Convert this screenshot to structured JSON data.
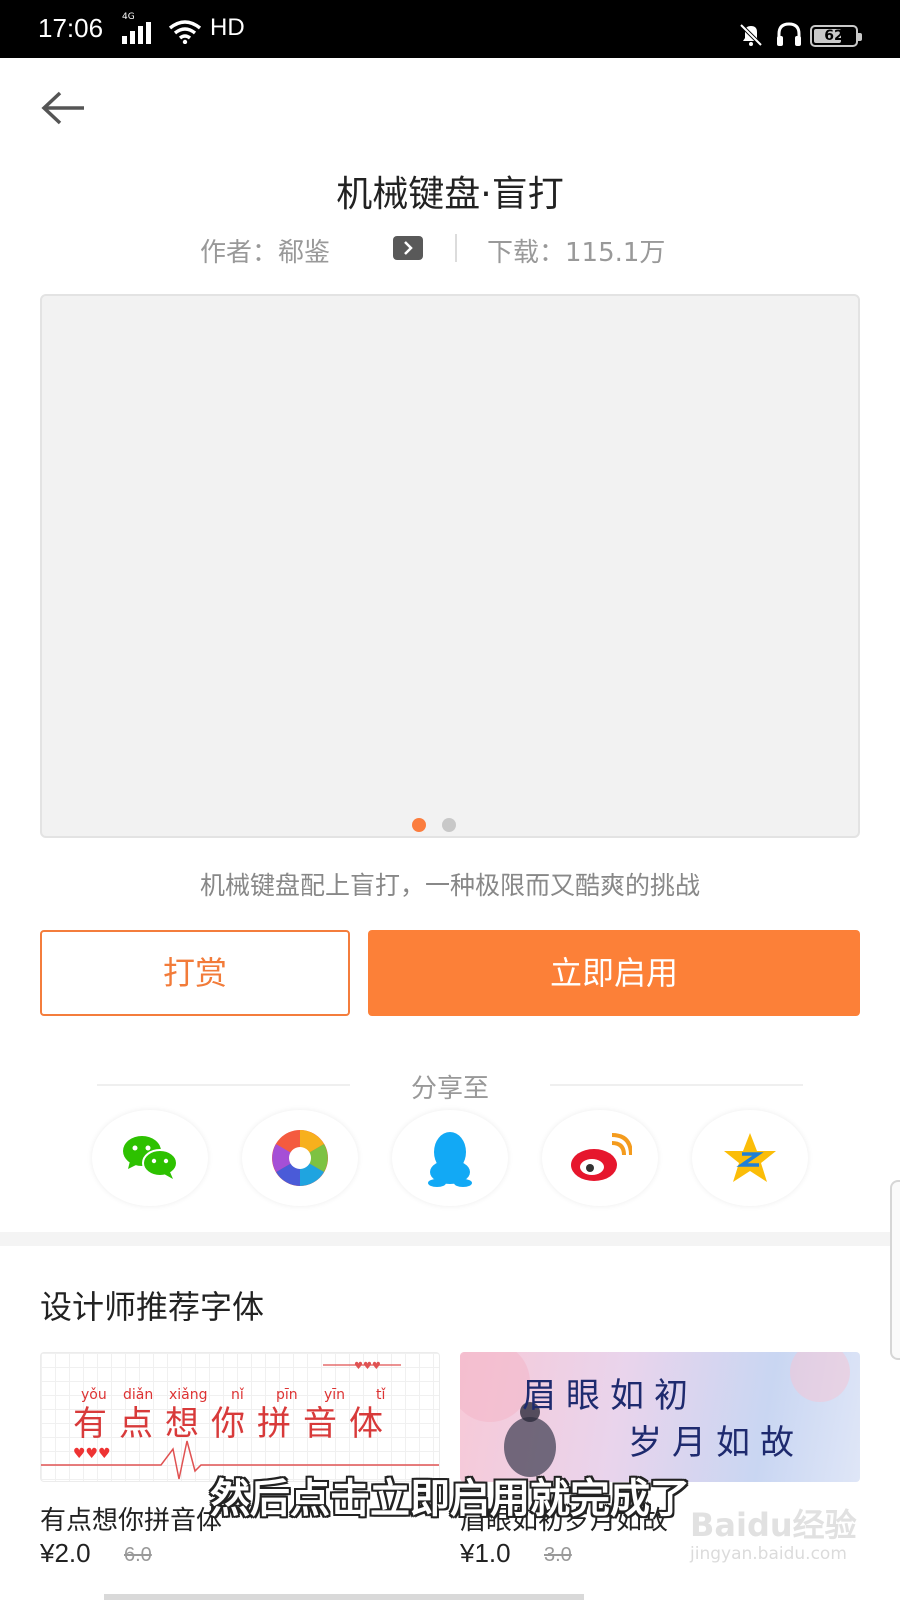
{
  "status_bar": {
    "time": "17:06",
    "network": "4G",
    "hd": "HD",
    "battery": "62"
  },
  "header": {
    "back_icon": "arrow-left-icon"
  },
  "theme": {
    "title": "机械键盘·盲打",
    "author": "作者：郗鉴",
    "downloads": "下载：115.1万",
    "description": "机械键盘配上盲打，一种极限而又酷爽的挑战",
    "carousel_pages": 2,
    "carousel_active": 1
  },
  "actions": {
    "tip_label": "打赏",
    "enable_label": "立即启用"
  },
  "share": {
    "title": "分享至",
    "targets": [
      "wechat-icon",
      "moments-icon",
      "qq-icon",
      "weibo-icon",
      "qzone-icon"
    ]
  },
  "recommend": {
    "title": "设计师推荐字体",
    "items": [
      {
        "name": "有点想你拼音体",
        "price": "¥2.0",
        "original_price": "6.0",
        "preview_text": "有点想你拼音体",
        "preview_pinyin": [
          "yǒu",
          "diǎn",
          "xiǎng",
          "nǐ",
          "pīn",
          "yīn",
          "tǐ"
        ]
      },
      {
        "name": "眉眼如初岁月如故",
        "price": "¥1.0",
        "original_price": "3.0",
        "preview_line1": "眉眼如初",
        "preview_line2": "岁月如故"
      }
    ]
  },
  "overlay": {
    "subtitle": "然后点击立即启用就完成了",
    "watermark_brand": "Baidu经验",
    "watermark_url": "jingyan.baidu.com"
  },
  "colors": {
    "accent": "#fc8038",
    "accent_border": "#f47d3c",
    "preview_bg": "#f2f2f2",
    "wechat": "#2dc100",
    "qq": "#12a9f5",
    "weibo": "#e6162d",
    "qzone": "#fbbd08"
  }
}
